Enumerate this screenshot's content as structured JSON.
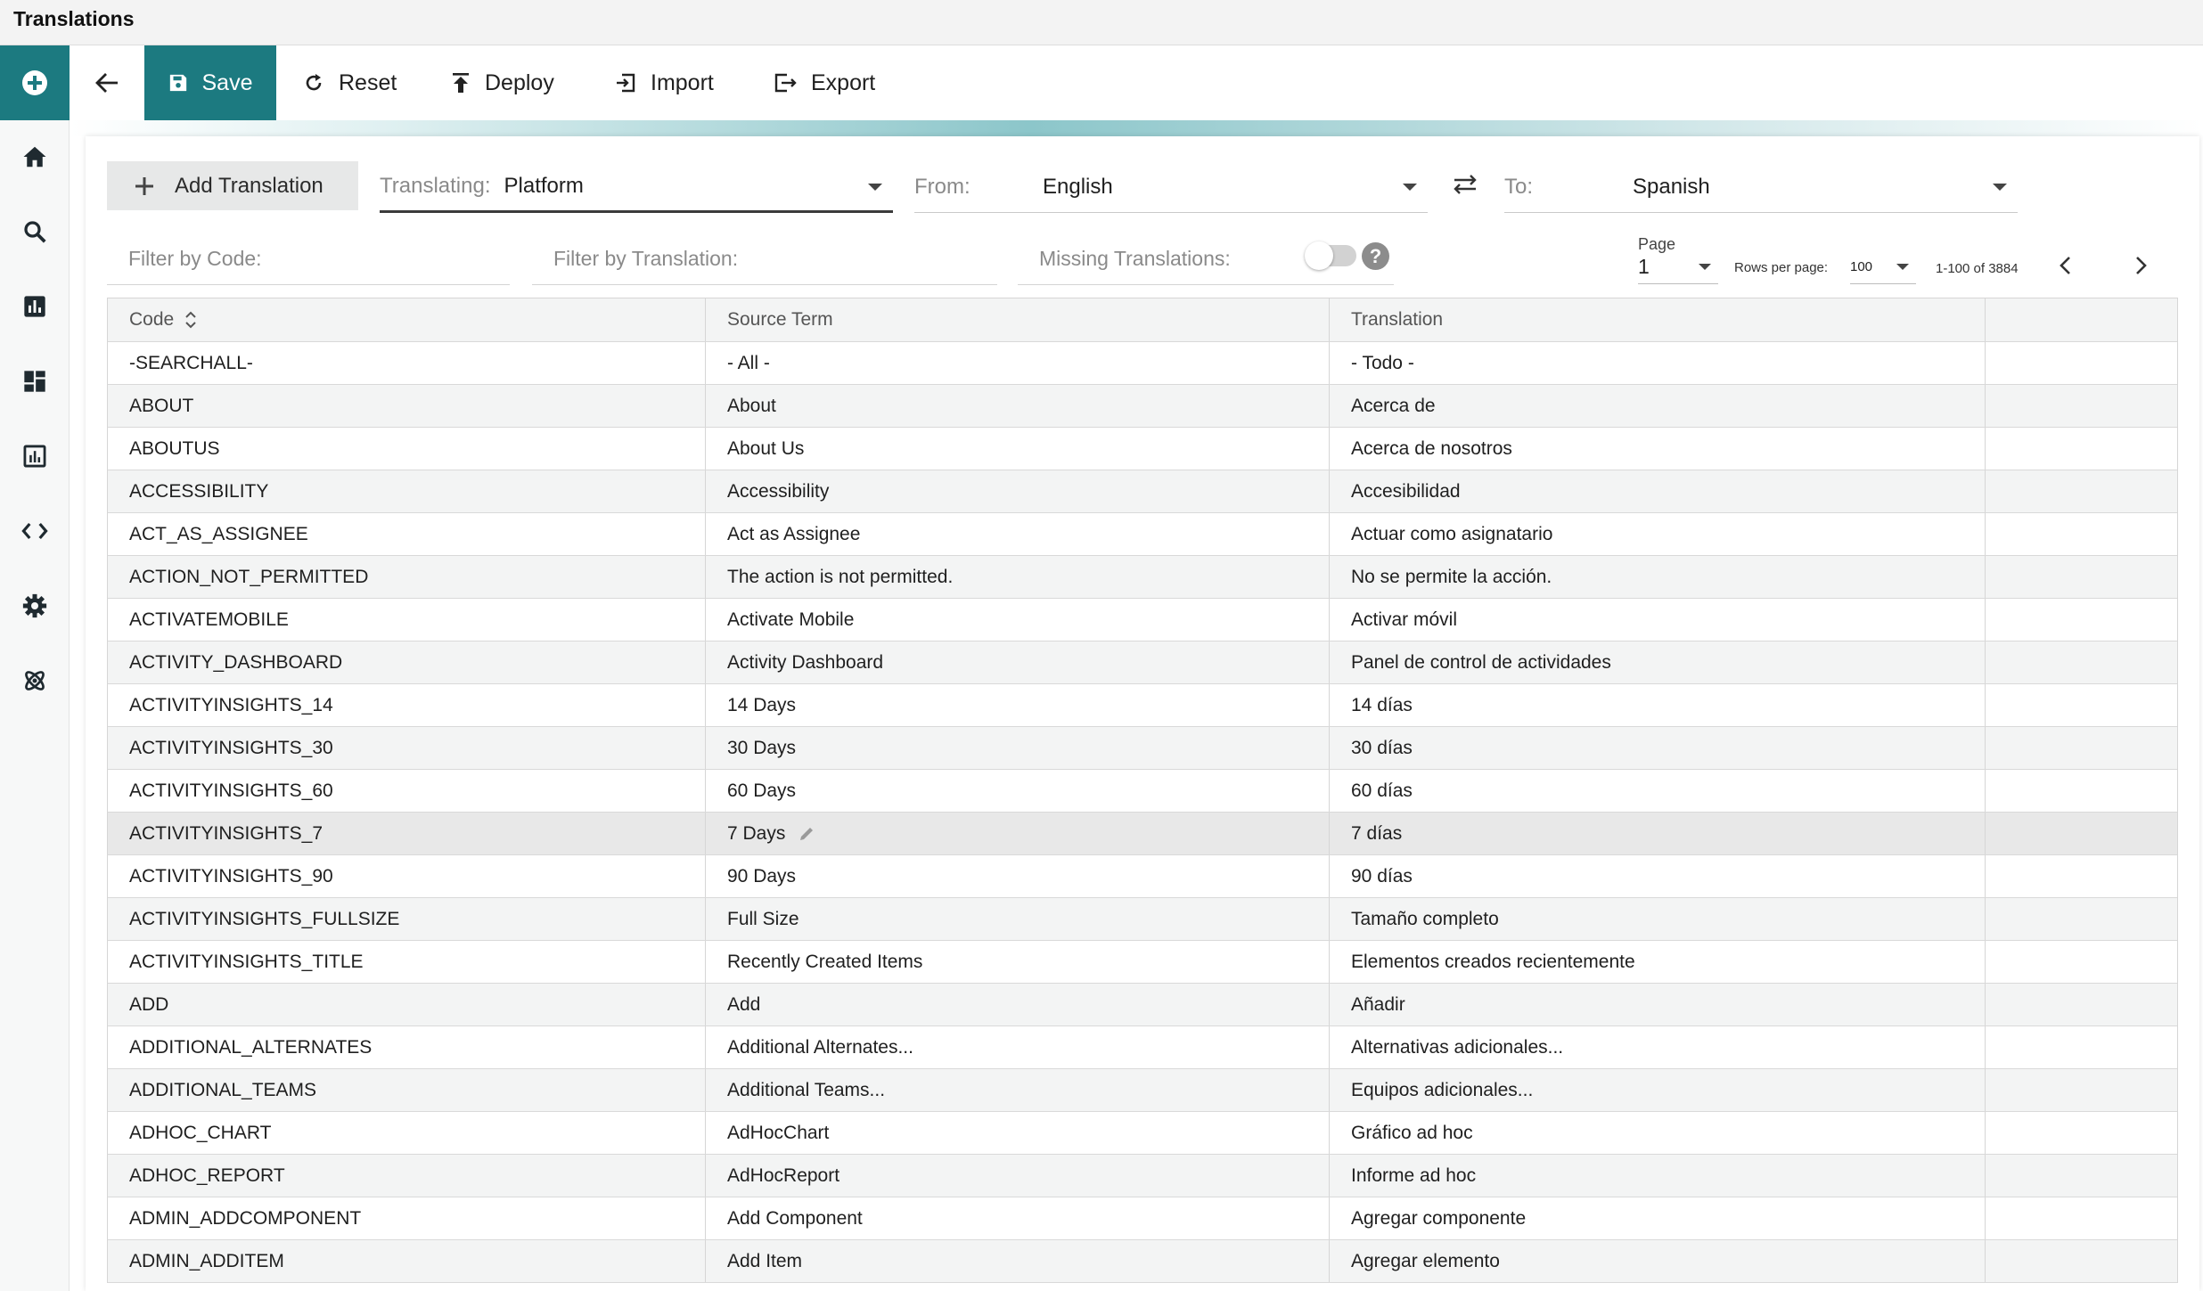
{
  "window": {
    "title": "Translations"
  },
  "toolbar": {
    "save_label": "Save",
    "reset_label": "Reset",
    "deploy_label": "Deploy",
    "import_label": "Import",
    "export_label": "Export"
  },
  "sidebar": {
    "items": [
      {
        "icon": "home-icon"
      },
      {
        "icon": "search-icon"
      },
      {
        "icon": "bar-chart-icon"
      },
      {
        "icon": "dashboard-icon"
      },
      {
        "icon": "report-icon"
      },
      {
        "icon": "code-icon"
      },
      {
        "icon": "gear-icon"
      },
      {
        "icon": "atom-icon"
      }
    ]
  },
  "controls": {
    "add_translation_label": "Add Translation",
    "translating_label": "Translating:",
    "translating_value": "Platform",
    "from_label": "From:",
    "from_value": "English",
    "to_label": "To:",
    "to_value": "Spanish",
    "filter_code_placeholder": "Filter by Code:",
    "filter_translation_placeholder": "Filter by Translation:",
    "missing_translations_label": "Missing Translations:",
    "missing_translations_on": false,
    "help_label": "?"
  },
  "pagination": {
    "page_label": "Page",
    "page_value": "1",
    "rows_per_page_label": "Rows per page:",
    "rows_per_page_value": "100",
    "range_text": "1-100 of 3884"
  },
  "table": {
    "columns": [
      "Code",
      "Source Term",
      "Translation",
      ""
    ],
    "rows": [
      [
        "-SEARCHALL-",
        "- All -",
        "- Todo -"
      ],
      [
        "ABOUT",
        "About",
        "Acerca de"
      ],
      [
        "ABOUTUS",
        "About Us",
        "Acerca de nosotros"
      ],
      [
        "ACCESSIBILITY",
        "Accessibility",
        "Accesibilidad"
      ],
      [
        "ACT_AS_ASSIGNEE",
        "Act as Assignee",
        "Actuar como asignatario"
      ],
      [
        "ACTION_NOT_PERMITTED",
        "The action is not permitted.",
        "No se permite la acción."
      ],
      [
        "ACTIVATEMOBILE",
        "Activate Mobile",
        "Activar móvil"
      ],
      [
        "ACTIVITY_DASHBOARD",
        "Activity Dashboard",
        "Panel de control de actividades"
      ],
      [
        "ACTIVITYINSIGHTS_14",
        "14 Days",
        "14 días"
      ],
      [
        "ACTIVITYINSIGHTS_30",
        "30 Days",
        "30 días"
      ],
      [
        "ACTIVITYINSIGHTS_60",
        "60 Days",
        "60 días"
      ],
      [
        "ACTIVITYINSIGHTS_7",
        "7 Days",
        "7 días"
      ],
      [
        "ACTIVITYINSIGHTS_90",
        "90 Days",
        "90 días"
      ],
      [
        "ACTIVITYINSIGHTS_FULLSIZE",
        "Full Size",
        "Tamaño completo"
      ],
      [
        "ACTIVITYINSIGHTS_TITLE",
        "Recently Created Items",
        "Elementos creados recientemente"
      ],
      [
        "ADD",
        "Add",
        "Añadir"
      ],
      [
        "ADDITIONAL_ALTERNATES",
        "Additional Alternates...",
        "Alternativas adicionales..."
      ],
      [
        "ADDITIONAL_TEAMS",
        "Additional Teams...",
        "Equipos adicionales..."
      ],
      [
        "ADHOC_CHART",
        "AdHocChart",
        "Gráfico ad hoc"
      ],
      [
        "ADHOC_REPORT",
        "AdHocReport",
        "Informe ad hoc"
      ],
      [
        "ADMIN_ADDCOMPONENT",
        "Add Component",
        "Agregar componente"
      ],
      [
        "ADMIN_ADDITEM",
        "Add Item",
        "Agregar elemento"
      ]
    ]
  },
  "colors": {
    "accent": "#1c7a80",
    "header_bg": "#f3f4f4",
    "text": "#1f1f1f"
  }
}
